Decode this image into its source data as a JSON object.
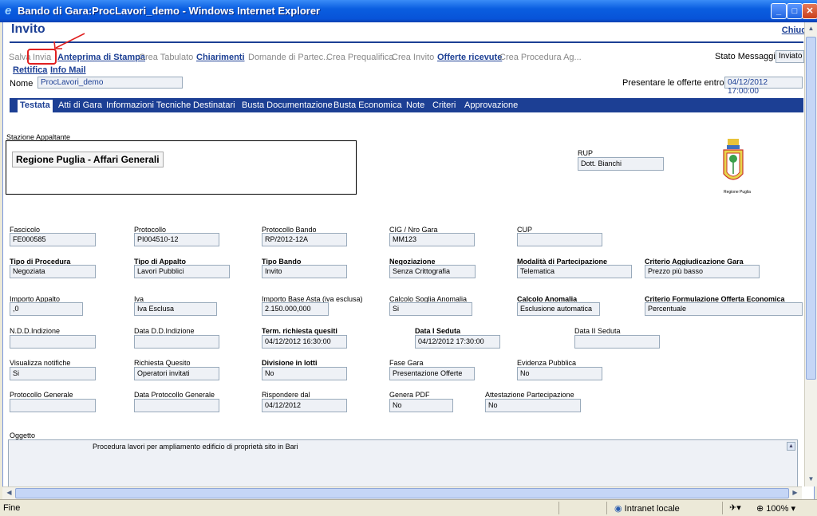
{
  "window": {
    "title": "Bando di Gara:ProcLavori_demo - Windows Internet Explorer",
    "controls": [
      "_",
      "□",
      "✕"
    ]
  },
  "page": {
    "title": "Invito",
    "close_link": "Chiudi"
  },
  "toolbar": {
    "salva": "Salva",
    "invia": "Invia",
    "anteprima": "Anteprima di Stampa",
    "crea_tabulato": "Crea Tabulato",
    "chiarimenti": "Chiarimenti",
    "domande": "Domande di Partec...",
    "crea_prequalifica": "Crea Prequalifica",
    "crea_invito": "Crea Invito",
    "offerte_ricevute": "Offerte ricevute",
    "crea_procedura": "Crea Procedura Ag...",
    "rettifica": "Rettifica",
    "info_mail": "Info Mail"
  },
  "stato": {
    "label": "Stato Messaggio",
    "value": "Inviato"
  },
  "nome": {
    "label": "Nome",
    "value": "ProcLavori_demo"
  },
  "presentare": {
    "label": "Presentare le offerte entro il:",
    "value": "04/12/2012 17:00:00"
  },
  "tabs": [
    "Testata",
    "Atti di Gara",
    "Informazioni Tecniche",
    "Destinatari",
    "Busta Documentazione",
    "Busta Economica",
    "Note",
    "Criteri",
    "Approvazione"
  ],
  "stazione": {
    "label": "Stazione Appaltante",
    "value": "Regione Puglia - Affari Generali"
  },
  "rup": {
    "label": "RUP",
    "value": "Dott. Bianchi"
  },
  "logo_caption": "Regione Puglia",
  "fields": {
    "fascicolo": {
      "label": "Fascicolo",
      "value": "FE000585"
    },
    "protocollo": {
      "label": "Protocollo",
      "value": "PI004510-12"
    },
    "protocollo_bando": {
      "label": "Protocollo Bando",
      "value": "RP/2012-12A"
    },
    "cig": {
      "label": "CIG / Nro Gara",
      "value": "MM123"
    },
    "cup": {
      "label": "CUP",
      "value": ""
    },
    "tipo_procedura": {
      "label": "Tipo di Procedura",
      "value": "Negoziata"
    },
    "tipo_appalto": {
      "label": "Tipo di Appalto",
      "value": "Lavori Pubblici"
    },
    "tipo_bando": {
      "label": "Tipo Bando",
      "value": "Invito"
    },
    "negoziazione": {
      "label": "Negoziazione",
      "value": "Senza Crittografia"
    },
    "modalita": {
      "label": "Modalità di Partecipazione",
      "value": "Telematica"
    },
    "criterio_agg": {
      "label": "Criterio Aggiudicazione Gara",
      "value": "Prezzo più basso"
    },
    "importo_appalto": {
      "label": "Importo Appalto",
      "value": ",0"
    },
    "iva": {
      "label": "Iva",
      "value": "Iva Esclusa"
    },
    "importo_base": {
      "label": "Importo Base Asta (iva esclusa)",
      "value": "2.150.000,000"
    },
    "calcolo_soglia": {
      "label": "Calcolo Soglia Anomalia",
      "value": "Si"
    },
    "calcolo_anomalia": {
      "label": "Calcolo Anomalia",
      "value": "Esclusione automatica"
    },
    "criterio_formula": {
      "label": "Criterio Formulazione Offerta Economica",
      "value": "Percentuale"
    },
    "ndd": {
      "label": "N.D.D.Indizione",
      "value": ""
    },
    "data_dd": {
      "label": "Data D.D.Indizione",
      "value": ""
    },
    "term_quesiti": {
      "label": "Term. richiesta quesiti",
      "value": "04/12/2012 16:30:00"
    },
    "data_i_seduta": {
      "label": "Data I Seduta",
      "value": "04/12/2012 17:30:00"
    },
    "data_ii_seduta": {
      "label": "Data II Seduta",
      "value": ""
    },
    "visualizza": {
      "label": "Visualizza notifiche",
      "value": "Si"
    },
    "richiesta_quesito": {
      "label": "Richiesta Quesito",
      "value": "Operatori invitati"
    },
    "divisione_lotti": {
      "label": "Divisione in lotti",
      "value": "No"
    },
    "fase_gara": {
      "label": "Fase Gara",
      "value": "Presentazione Offerte"
    },
    "evidenza": {
      "label": "Evidenza Pubblica",
      "value": "No"
    },
    "protocollo_generale": {
      "label": "Protocollo Generale",
      "value": ""
    },
    "data_protocollo": {
      "label": "Data Protocollo Generale",
      "value": ""
    },
    "rispondere_dal": {
      "label": "Rispondere dal",
      "value": "04/12/2012"
    },
    "genera_pdf": {
      "label": "Genera PDF",
      "value": "No"
    },
    "attestazione": {
      "label": "Attestazione Partecipazione",
      "value": "No"
    }
  },
  "oggetto": {
    "label": "Oggetto",
    "value": "Procedura lavori per ampliamento edificio di proprietà sito in Bari"
  },
  "statusbar": {
    "text": "Fine",
    "zone": "Intranet locale",
    "zoom": "100%"
  },
  "colors": {
    "accent": "#1c3f94",
    "highlight": "#e02020",
    "field_bg": "#eef1f6"
  }
}
